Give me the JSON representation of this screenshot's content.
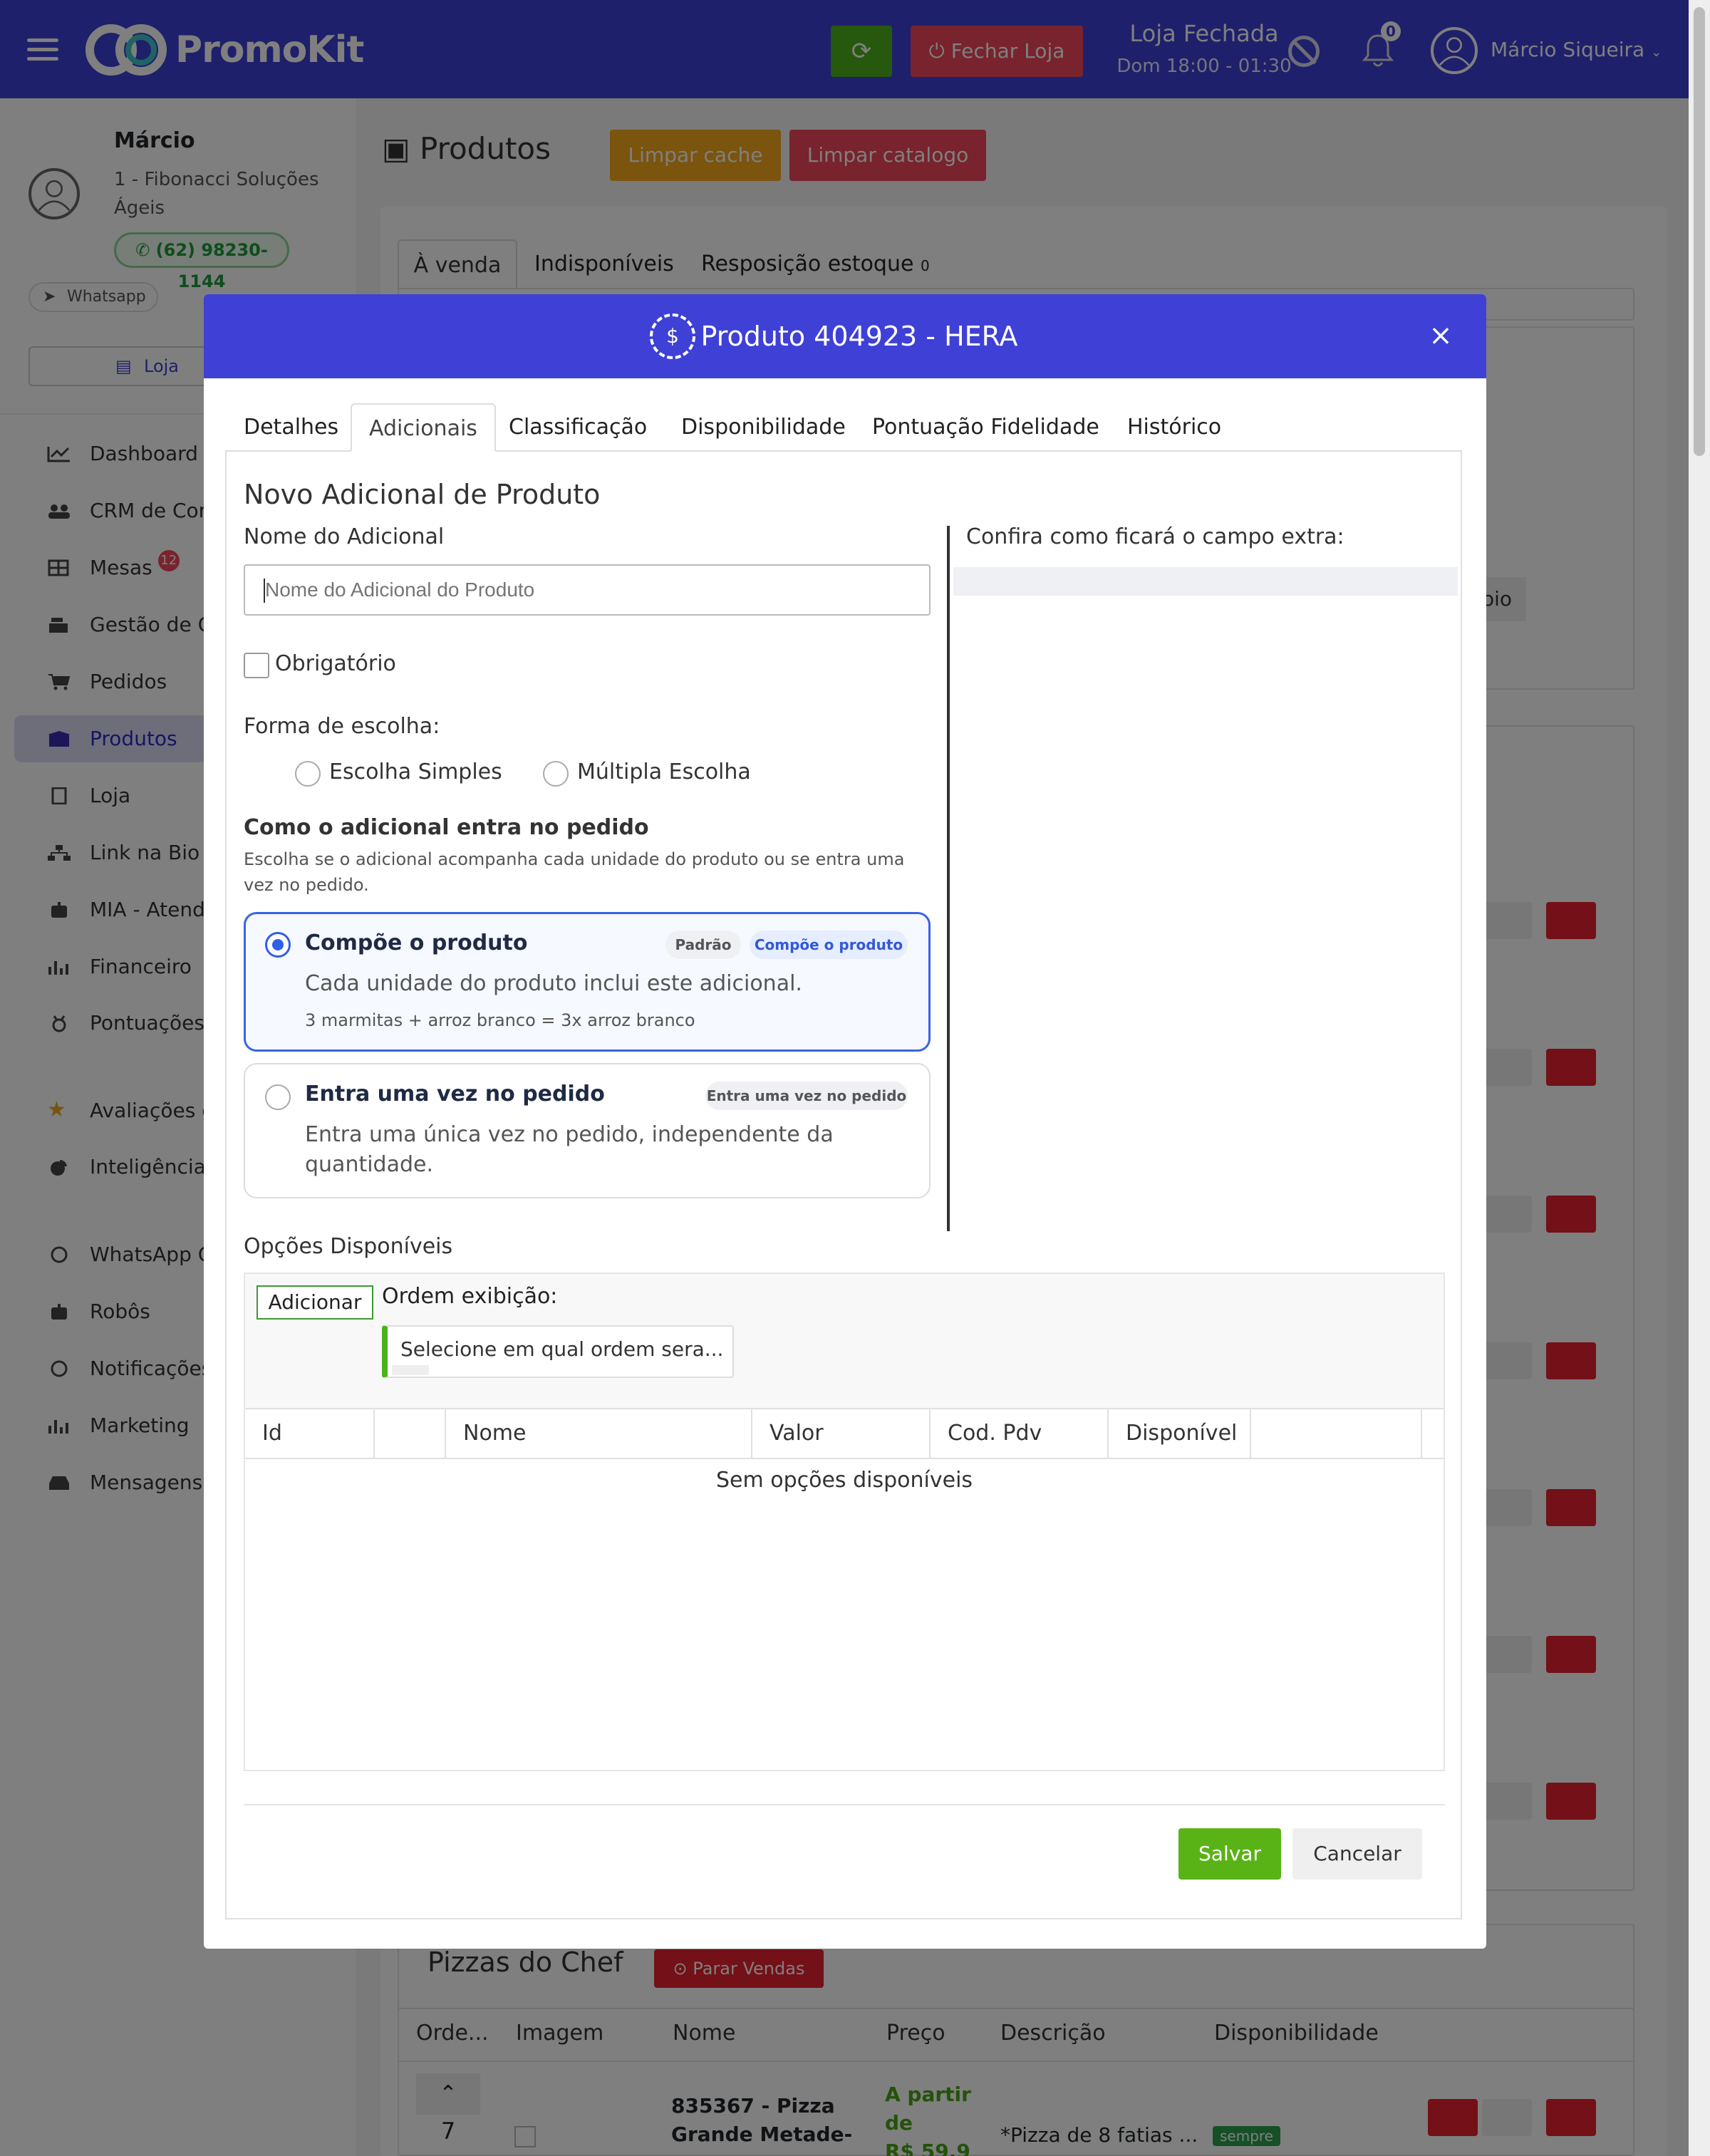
{
  "header": {
    "brand": "PromoKit",
    "close_store_label": "Fechar Loja",
    "store_status": "Loja Fechada",
    "store_hours": "Dom 18:00 - 01:30",
    "notifications_count": "0",
    "user_name": "Márcio Siqueira",
    "colors": {
      "primary": "#3f40d6",
      "success": "#4cb21a",
      "danger": "#f0475a"
    }
  },
  "sidebar": {
    "user": "Márcio",
    "company": "1 - Fibonacci Soluções Ágeis",
    "phone": "(62) 98230-1144",
    "whatsapp_label": "Whatsapp",
    "store_button": "Loja",
    "items": [
      {
        "label": "Dashboard",
        "icon": "chart-line-icon"
      },
      {
        "label": "CRM de Con",
        "icon": "users-icon"
      },
      {
        "label": "Mesas",
        "icon": "table-icon",
        "badge": "12"
      },
      {
        "label": "Gestão de C",
        "icon": "cash-register-icon"
      },
      {
        "label": "Pedidos",
        "icon": "cart-icon"
      },
      {
        "label": "Produtos",
        "icon": "box-icon"
      },
      {
        "label": "Loja",
        "icon": "building-icon"
      },
      {
        "label": "Link na Bio",
        "icon": "sitemap-icon"
      },
      {
        "label": "MIA - Atend",
        "icon": "robot-icon"
      },
      {
        "label": "Financeiro",
        "icon": "bar-chart-icon"
      },
      {
        "label": "Pontuações Fidelidade",
        "icon": "medal-icon"
      },
      {
        "label": "Avaliações d",
        "icon": "star-icon"
      },
      {
        "label": "Inteligência Negócio",
        "icon": "pie-chart-icon"
      },
      {
        "label": "WhatsApp C",
        "icon": "whatsapp-icon"
      },
      {
        "label": "Robôs",
        "icon": "robot-icon"
      },
      {
        "label": "Notificações",
        "icon": "whatsapp-icon"
      },
      {
        "label": "Marketing",
        "icon": "bar-chart-icon"
      },
      {
        "label": "Mensagens",
        "icon": "inbox-icon"
      }
    ]
  },
  "page": {
    "title": "Produtos",
    "clear_cache": "Limpar cache",
    "clear_catalog": "Limpar catalogo",
    "tabs": [
      "À venda",
      "Indisponíveis",
      "Resposição estoque"
    ],
    "restock_count": "0",
    "partial_text": "oio",
    "pizza_section": {
      "title": "Pizzas do Chef",
      "stop_sales": "Parar Vendas",
      "columns": [
        "Orde...",
        "Imagem",
        "Nome",
        "Preço",
        "Descrição",
        "Disponibilidade"
      ],
      "row": {
        "order": "7",
        "name_line1": "835367 - Pizza",
        "name_line2": "Grande Metade-",
        "price_line1": "A partir",
        "price_line2": "de",
        "price_line3": "R$ 59,9",
        "description": "*Pizza de 8 fatias ...",
        "availability": "sempre"
      }
    }
  },
  "modal": {
    "title": "Produto 404923 - HERA",
    "tabs": [
      "Detalhes",
      "Adicionais",
      "Classificação",
      "Disponibilidade",
      "Pontuação Fidelidade",
      "Histórico"
    ],
    "active_tab": "Adicionais",
    "section_title": "Novo Adicional de Produto",
    "name_label": "Nome do Adicional",
    "name_placeholder": "Nome do Adicional do Produto",
    "required_label": "Obrigatório",
    "choice_label": "Forma de escolha:",
    "choice_simple": "Escolha Simples",
    "choice_multiple": "Múltipla Escolha",
    "mode_title": "Como o adicional entra no pedido",
    "mode_desc_1": "Escolha se o adicional acompanha cada unidade do produto ou se entra uma",
    "mode_desc_2": "vez no pedido.",
    "option_compose": {
      "title": "Compõe o produto",
      "pill_default": "Padrão",
      "pill_tag": "Compõe o produto",
      "desc": "Cada unidade do produto inclui este adicional.",
      "example": "3 marmitas + arroz branco = 3x arroz branco",
      "selected": true
    },
    "option_once": {
      "title": "Entra uma vez no pedido",
      "pill_tag": "Entra uma vez no pedido",
      "desc_1": "Entra uma única vez no pedido, independente da",
      "desc_2": "quantidade.",
      "selected": false
    },
    "preview_label": "Confira como ficará o campo extra:",
    "options_title": "Opções Disponíveis",
    "add_button": "Adicionar",
    "order_label": "Ordem exibição:",
    "order_placeholder": "Selecione em qual ordem sera...",
    "grid_columns": [
      "Id",
      "",
      "Nome",
      "Valor",
      "Cod. Pdv",
      "Disponível"
    ],
    "grid_empty": "Sem opções disponíveis",
    "save": "Salvar",
    "cancel": "Cancelar"
  }
}
